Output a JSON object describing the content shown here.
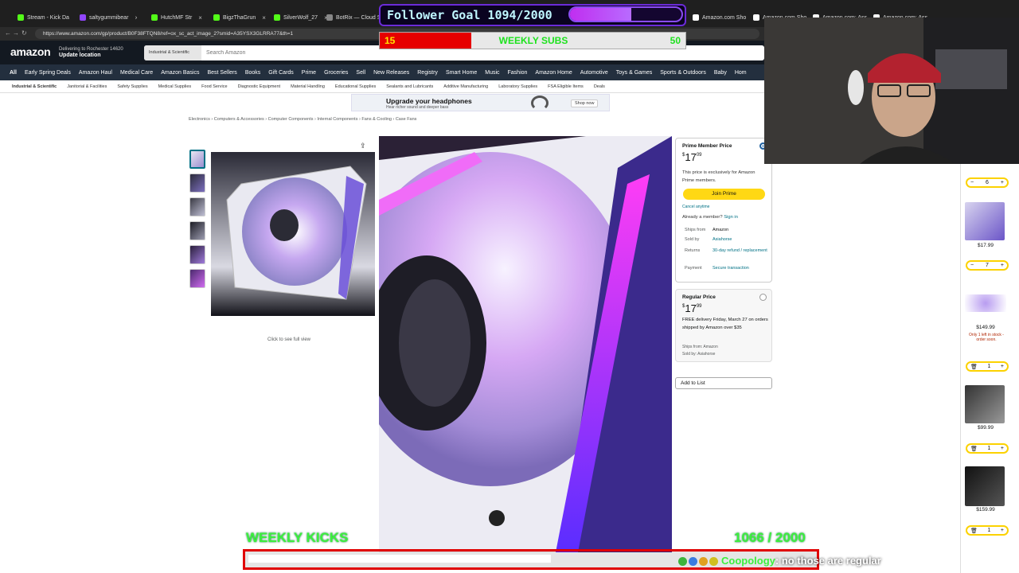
{
  "browser": {
    "tabs": [
      {
        "label": "Stream - Kick Da",
        "color": "#53fc18"
      },
      {
        "label": "saltygummibear",
        "color": "#9146ff"
      },
      {
        "label": "HutchMF Str",
        "color": "#53fc18"
      },
      {
        "label": "BigzThaGrun",
        "color": "#53fc18"
      },
      {
        "label": "SilverWolf_27",
        "color": "#53fc18"
      },
      {
        "label": "BotRix — Cloud S",
        "color": "#888888"
      },
      {
        "label": "Amazon.com Sho",
        "color": "#ffffff"
      },
      {
        "label": "Amazon.com Sho",
        "color": "#ffffff"
      },
      {
        "label": "Amazon.com: Ass",
        "color": "#ffffff"
      },
      {
        "label": "Amazon.com: Ass",
        "color": "#ffffff"
      }
    ],
    "url": "https://www.amazon.com/gp/product/B0F38FTQN8/ref=ox_sc_act_image_2?smid=A35YSX3GLRRA77&th=1"
  },
  "amazon": {
    "logo": "amazon",
    "deliver_line1": "Delivering to Rochester 14620",
    "deliver_line2": "Update location",
    "search_category": "Industrial & Scientific",
    "search_placeholder": "Search Amazon",
    "nav": [
      "All",
      "Early Spring Deals",
      "Amazon Haul",
      "Medical Care",
      "Amazon Basics",
      "Best Sellers",
      "Books",
      "Gift Cards",
      "Prime",
      "Groceries",
      "Sell",
      "New Releases",
      "Registry",
      "Smart Home",
      "Music",
      "Fashion",
      "Amazon Home",
      "Automotive",
      "Toys & Games",
      "Sports & Outdoors",
      "Baby",
      "Hom"
    ],
    "subnav": [
      "Industrial & Scientific",
      "Janitorial & Facilities",
      "Safety Supplies",
      "Medical Supplies",
      "Food Service",
      "Diagnostic Equipment",
      "Material Handling",
      "Educational Supplies",
      "Sealants and Lubricants",
      "Additive Manufacturing",
      "Laboratory Supplies",
      "FSA Eligible Items",
      "Deals"
    ],
    "banner_title": "Upgrade your headphones",
    "banner_sub": "Hear richer sound and deeper bass",
    "banner_btn": "Shop now",
    "breadcrumb": "Electronics › Computers & Accessories › Computer Components › Internal Components › Fans & Cooling › Case Fans",
    "click_full_view": "Click to see full view"
  },
  "buybox": {
    "prime_label": "Prime Member Price",
    "prime_price_dollars": "17",
    "prime_price_cents": "09",
    "currency": "$",
    "prime_note": "This price is exclusively for Amazon Prime members.",
    "join_prime": "Join Prime",
    "cancel": "Cancel anytime",
    "already_member": "Already a member?",
    "sign_in": "Sign in",
    "ships_from_k": "Ships from",
    "ships_from_v": "Amazon",
    "sold_by_k": "Sold by",
    "sold_by_v": "Asiahorse",
    "returns_k": "Returns",
    "returns_v": "30-day refund / replacement",
    "payment_k": "Payment",
    "payment_v": "Secure transaction",
    "regular_label": "Regular Price",
    "regular_dollars": "17",
    "regular_cents": "99",
    "delivery": "FREE delivery Friday, March 27 on orders shipped by Amazon over $35",
    "ships_from_line": "Ships from: Amazon",
    "sold_by_line": "Sold by: Asiahorse",
    "add_to_list": "Add to List"
  },
  "cart": {
    "items": [
      {
        "qty": "6",
        "price": ""
      },
      {
        "qty": "7",
        "price": "$17.99"
      },
      {
        "qty": "1",
        "price": "$149.99",
        "note": "Only 1 left in stock - order soon."
      },
      {
        "qty": "1",
        "price": "$99.99"
      },
      {
        "qty": "1",
        "price": "$159.99"
      }
    ]
  },
  "overlay": {
    "follower_goal": "Follower Goal 1094/2000",
    "follower_progress": 0.547,
    "weekly_subs_label": "WEEKLY SUBS",
    "weekly_subs_current": "15",
    "weekly_subs_goal": "50",
    "weekly_subs_progress": 0.3,
    "weekly_kicks_label": "WEEKLY KICKS",
    "weekly_kicks_count": "1066  / 2000",
    "chat_user": "Coopology",
    "chat_sep": ":",
    "chat_text": "no those are regular"
  }
}
